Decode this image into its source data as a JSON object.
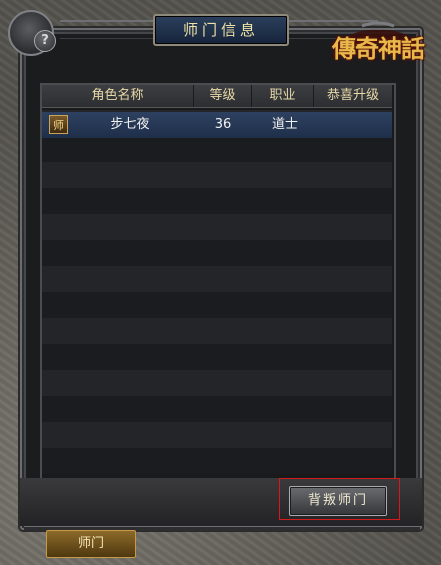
{
  "window": {
    "title": "师门信息",
    "help_icon": "?",
    "logo_text": "傳奇神話"
  },
  "table": {
    "columns": [
      "角色名称",
      "等级",
      "职业",
      "恭喜升级"
    ],
    "rows": [
      {
        "badge": "师",
        "name": "步七夜",
        "level": "36",
        "class": "道士",
        "congrats": ""
      }
    ]
  },
  "actions": {
    "betray_label": "背叛师门"
  },
  "tabs": [
    {
      "label": "师门"
    }
  ],
  "colors": {
    "accent_gold": "#e8d9a8",
    "selected_row": "#2e4160",
    "highlight_red": "#d51a1a"
  }
}
